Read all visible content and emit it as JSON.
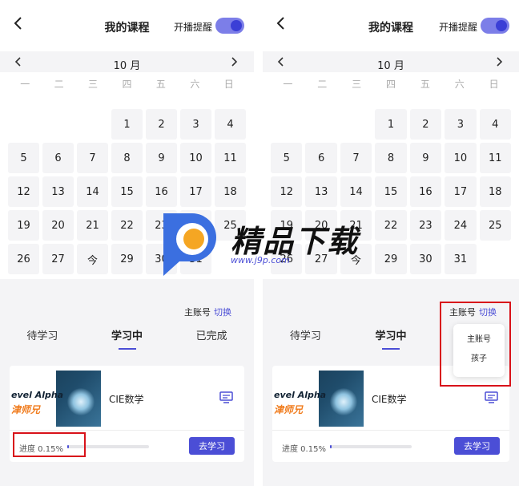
{
  "header": {
    "title": "我的课程",
    "remind_label": "开播提醒",
    "remind_on": true
  },
  "calendar": {
    "month_label": "10 月",
    "weekdays": [
      "一",
      "二",
      "三",
      "四",
      "五",
      "六",
      "日"
    ],
    "leading_blanks": 3,
    "days": [
      "1",
      "2",
      "3",
      "4",
      "5",
      "6",
      "7",
      "8",
      "9",
      "10",
      "11",
      "12",
      "13",
      "14",
      "15",
      "16",
      "17",
      "18",
      "19",
      "20",
      "21",
      "22",
      "23",
      "24",
      "25",
      "26",
      "27",
      "今",
      "29",
      "30",
      "31"
    ]
  },
  "account": {
    "label": "主账号",
    "switch_label": "切换"
  },
  "tabs": [
    {
      "label": "待学习",
      "active": false
    },
    {
      "label": "学习中",
      "active": true
    },
    {
      "label": "已完成",
      "active": false
    }
  ],
  "course": {
    "thumb_title": "evel Alpha",
    "thumb_subtitle": "津师兄",
    "name": "CIE数学",
    "progress_text": "进度 0.15%",
    "progress_percent": 0.15,
    "go_label": "去学习"
  },
  "dropdown": {
    "items": [
      "主账号",
      "孩子"
    ]
  },
  "watermark": {
    "title": "精品下载",
    "url": "www.j9p.com"
  },
  "colors": {
    "accent": "#4b4ed6",
    "highlight": "#d8121a",
    "background": "#f4f4f6"
  }
}
